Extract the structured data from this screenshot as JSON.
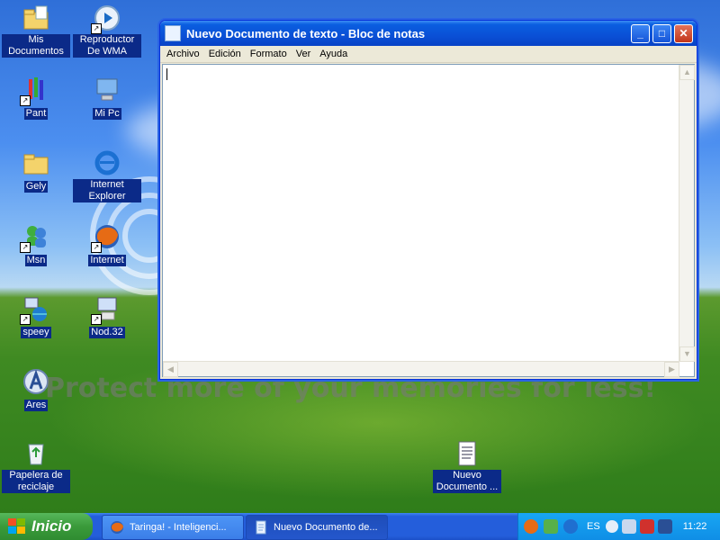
{
  "desktop": {
    "icons": [
      {
        "label": "Mis Documentos"
      },
      {
        "label": "Reproductor De WMA"
      },
      {
        "label": "Pant"
      },
      {
        "label": "Mi Pc"
      },
      {
        "label": "Gely"
      },
      {
        "label": "Internet Explorer"
      },
      {
        "label": "Msn"
      },
      {
        "label": "Internet"
      },
      {
        "label": "speey"
      },
      {
        "label": "Nod.32"
      },
      {
        "label": "Ares"
      },
      {
        "label": "Papelera de reciclaje"
      },
      {
        "label": "Nuevo Documento ..."
      }
    ],
    "watermark": "Protect more of your memories for less!"
  },
  "notepad": {
    "title": "Nuevo Documento de texto - Bloc de notas",
    "menu": [
      "Archivo",
      "Edición",
      "Formato",
      "Ver",
      "Ayuda"
    ],
    "content": ""
  },
  "taskbar": {
    "start_label": "Inicio",
    "buttons": [
      {
        "label": "Taringa! - Inteligenci..."
      },
      {
        "label": "Nuevo Documento de..."
      }
    ],
    "language": "ES",
    "clock": "11:22"
  }
}
